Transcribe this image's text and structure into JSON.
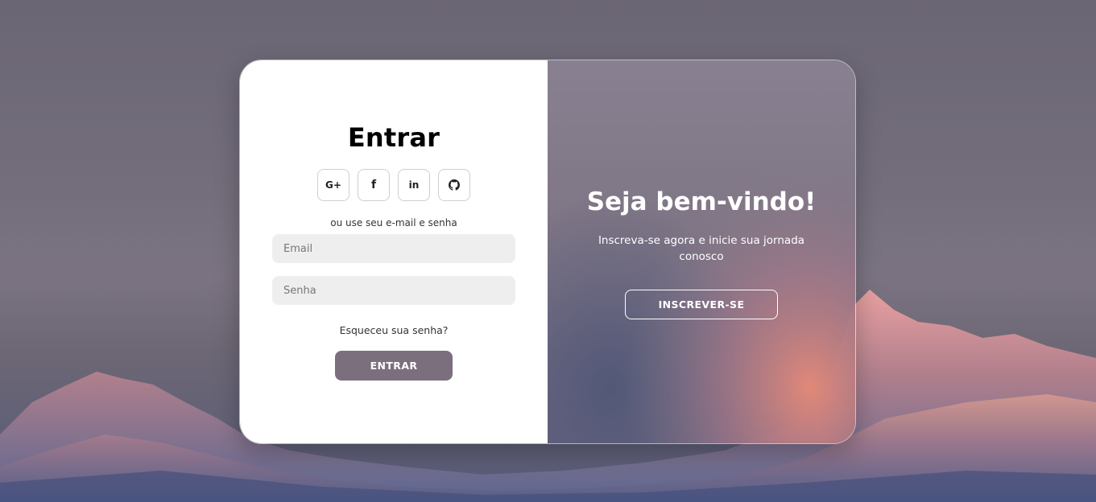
{
  "signin": {
    "title": "Entrar",
    "social_buttons": [
      {
        "icon": "google-plus-icon",
        "glyph": "G+"
      },
      {
        "icon": "facebook-icon",
        "glyph": "f"
      },
      {
        "icon": "linkedin-icon",
        "glyph": "in"
      },
      {
        "icon": "github-icon",
        "glyph": "◉"
      }
    ],
    "divider_text": "ou use seu e-mail e senha",
    "email_placeholder": "Email",
    "password_placeholder": "Senha",
    "forgot_label": "Esqueceu sua senha?",
    "submit_label": "ENTRAR"
  },
  "welcome": {
    "title": "Seja bem-vindo!",
    "subtitle": "Inscreva-se agora e inicie sua jornada conosco",
    "signup_label": "INSCREVER-SE"
  },
  "colors": {
    "accent": "#7b6f7d",
    "input_bg": "#eeeeee",
    "panel_overlay": "#857c8c"
  }
}
